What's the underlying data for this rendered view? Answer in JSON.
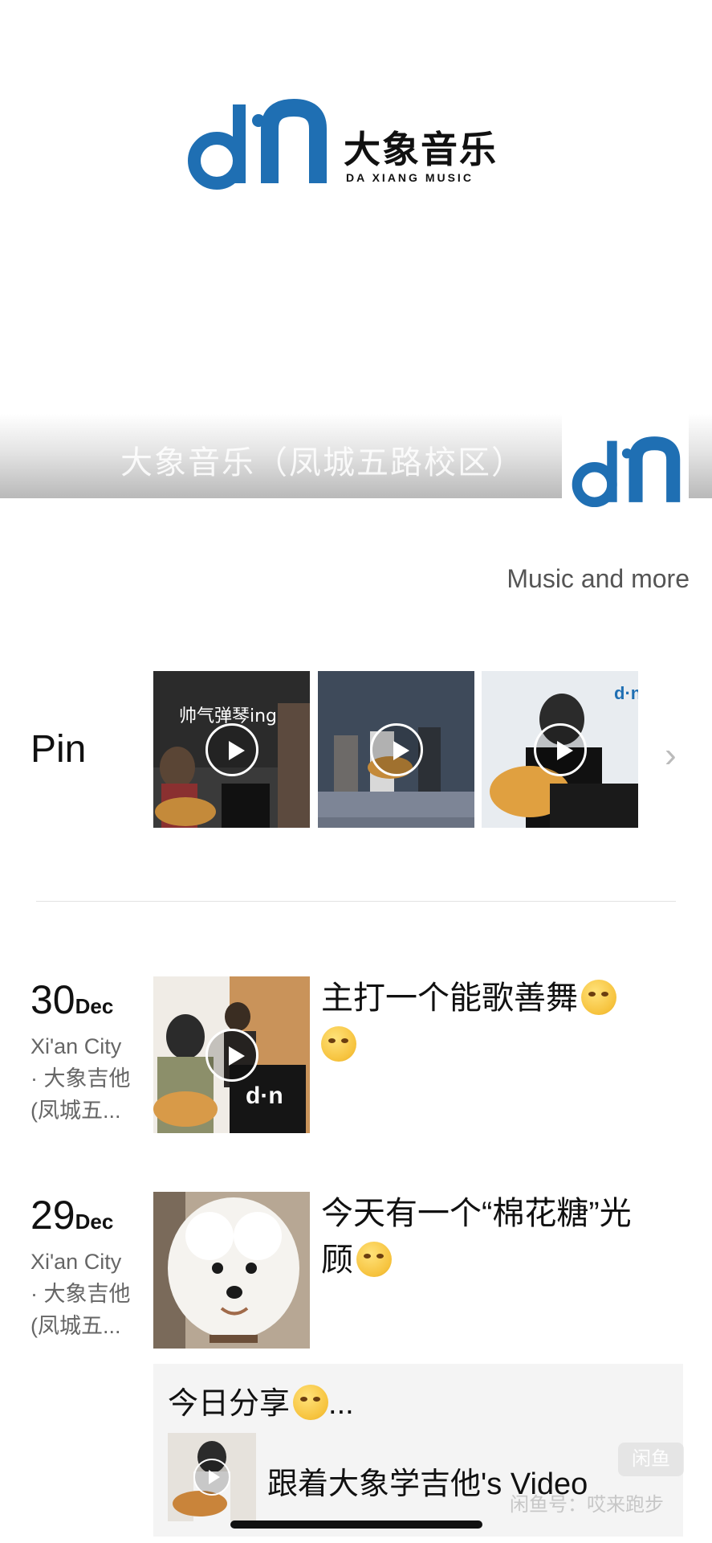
{
  "brand": {
    "name_cn": "大象音乐",
    "name_en": "DA XIANG MUSIC",
    "logo_color": "#1f6fb3"
  },
  "banner": {
    "title": "大象音乐（凤城五路校区）"
  },
  "profile": {
    "motto": "Music and more"
  },
  "pinned": {
    "label": "Pin",
    "thumbs": [
      {
        "caption": "帅气弹琴ing",
        "has_play": true
      },
      {
        "caption": "",
        "has_play": true
      },
      {
        "caption": "",
        "has_play": true
      }
    ],
    "more_icon": "chevron-right-icon"
  },
  "posts": [
    {
      "day": "30",
      "month": "Dec",
      "location_line1": "Xi'an City",
      "location_line2": "· 大象吉他",
      "location_line3": "(凤城五...",
      "text": "主打一个能歌善舞",
      "emojis": [
        "smirk-emoji",
        "smirk-emoji"
      ],
      "thumb_has_play": true
    },
    {
      "day": "29",
      "month": "Dec",
      "location_line1": "Xi'an City",
      "location_line2": "· 大象吉他",
      "location_line3": "(凤城五...",
      "text_line1": "今天有一个“棉花糖”光",
      "text_line2": "顾",
      "emojis": [
        "smile-emoji"
      ],
      "thumb_has_play": false
    }
  ],
  "shared": {
    "text": "今日分享",
    "ellipsis": "...",
    "video_title": "跟着大象学吉他's Video"
  },
  "watermark": {
    "badge": "闲鱼",
    "text": "闲鱼号：哎来跑步"
  }
}
